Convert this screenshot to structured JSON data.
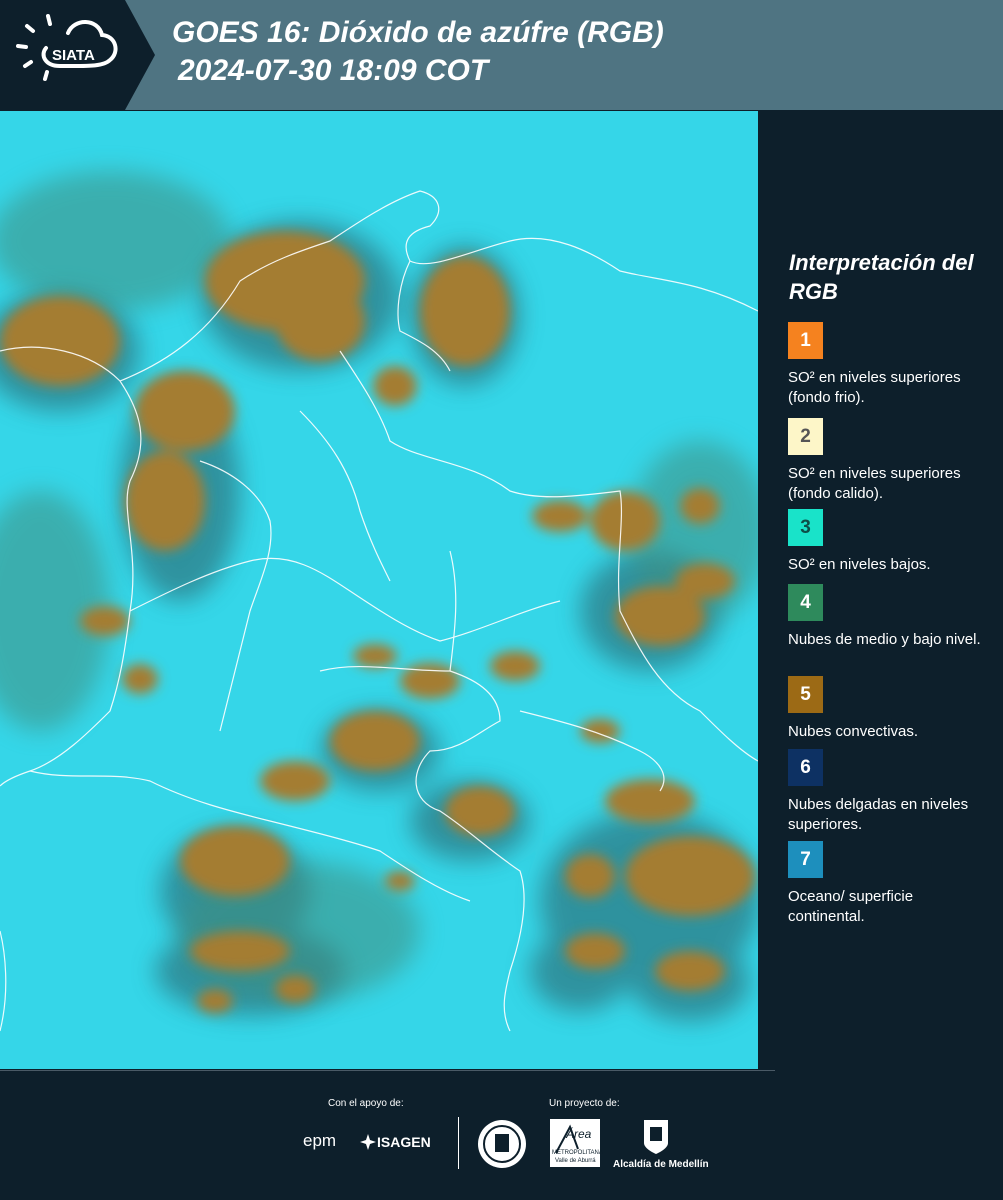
{
  "header": {
    "logo_text": "SIATA",
    "title_line1": "GOES 16: Dióxido de azúfre (RGB)",
    "title_line2": "2024-07-30 18:09 COT"
  },
  "legend": {
    "title": "Interpretación del RGB",
    "items": [
      {
        "number": "1",
        "color": "#f5821f",
        "text_color": "#ffffff",
        "label": "SO² en niveles superiores (fondo frio)."
      },
      {
        "number": "2",
        "color": "#fdf6c8",
        "text_color": "#555555",
        "label": "SO² en niveles superiores (fondo calido)."
      },
      {
        "number": "3",
        "color": "#19e3c9",
        "text_color": "#0d4f48",
        "label": "SO² en niveles bajos."
      },
      {
        "number": "4",
        "color": "#2e8a5c",
        "text_color": "#ffffff",
        "label": "Nubes de medio y bajo nivel."
      },
      {
        "number": "5",
        "color": "#9c6a15",
        "text_color": "#ffffff",
        "label": "Nubes convectivas."
      },
      {
        "number": "6",
        "color": "#0d3163",
        "text_color": "#ffffff",
        "label": "Nubes delgadas en niveles superiores."
      },
      {
        "number": "7",
        "color": "#1d8fbd",
        "text_color": "#ffffff",
        "label": "Oceano/ superficie continental."
      }
    ]
  },
  "footer": {
    "support_label": "Con el apoyo de:",
    "project_label": "Un proyecto de:",
    "partner_epm": "epm",
    "partner_isagen": "ISAGEN",
    "partner_area": "Área",
    "partner_area_sub": "METROPOLITANA",
    "partner_area_sub2": "Valle de Aburrá",
    "partner_alcaldia": "Alcaldía de Medellín"
  },
  "map": {
    "background_color": "#35d6e8",
    "cloud_color": "#a47d33",
    "border_color": "#ffffff"
  }
}
